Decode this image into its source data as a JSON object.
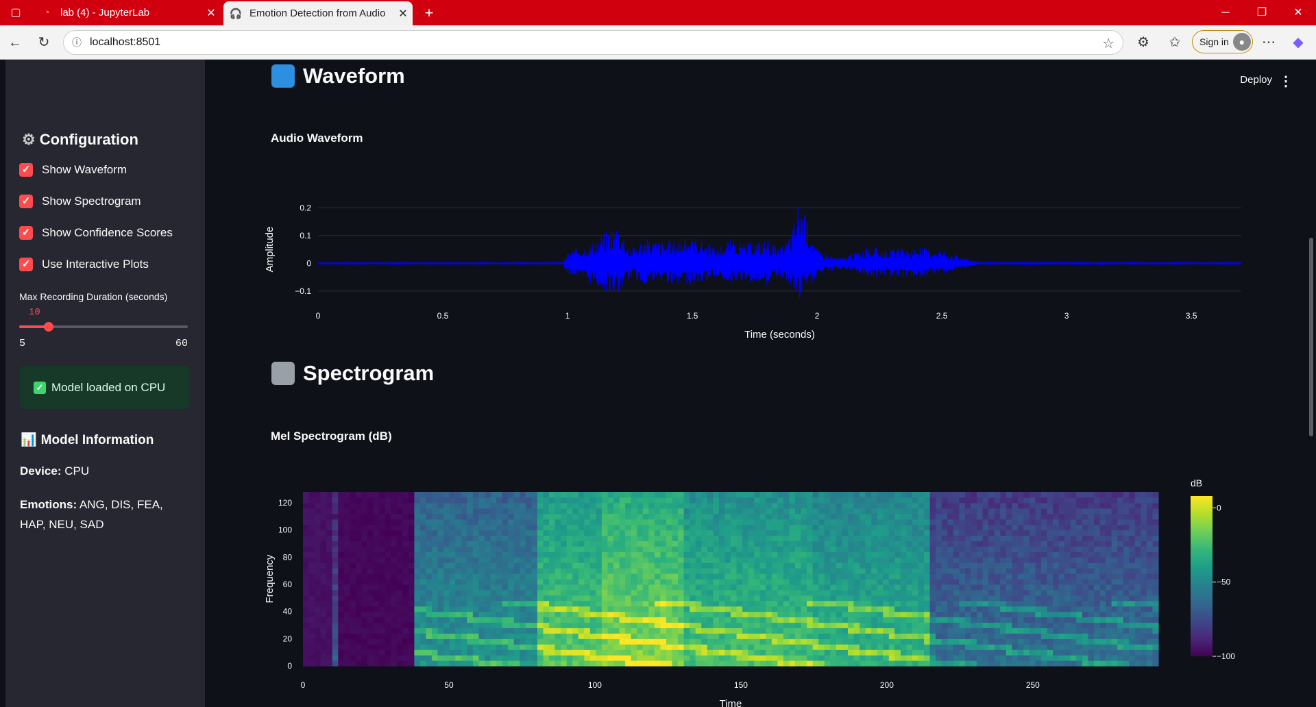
{
  "browser": {
    "tabs": [
      {
        "title": "lab (4) - JupyterLab",
        "icon": "jupyter-icon"
      },
      {
        "title": "Emotion Detection from Audio",
        "icon": "headphones-icon"
      }
    ],
    "url": "localhost:8501",
    "signin_label": "Sign in"
  },
  "sidebar": {
    "config_title": "Configuration",
    "checkboxes": [
      {
        "label": "Show Waveform",
        "checked": true
      },
      {
        "label": "Show Spectrogram",
        "checked": true
      },
      {
        "label": "Show Confidence Scores",
        "checked": true
      },
      {
        "label": "Use Interactive Plots",
        "checked": true
      }
    ],
    "slider": {
      "label": "Max Recording Duration (seconds)",
      "value": "10",
      "min": "5",
      "max": "60"
    },
    "status": "Model loaded on CPU",
    "model_info_title": "Model Information",
    "device_label": "Device:",
    "device_value": " CPU",
    "emotions_label": "Emotions:",
    "emotions_value": " ANG, DIS, FEA, HAP, NEU, SAD"
  },
  "main": {
    "deploy_label": "Deploy",
    "waveform_title": "Waveform",
    "spectrogram_title": "Spectrogram"
  },
  "chart_data": [
    {
      "type": "line",
      "title": "Audio Waveform",
      "xlabel": "Time (seconds)",
      "ylabel": "Amplitude",
      "xlim": [
        0,
        3.7
      ],
      "ylim": [
        -0.13,
        0.26
      ],
      "xticks": [
        "0",
        "0.5",
        "1",
        "1.5",
        "2",
        "2.5",
        "3",
        "3.5"
      ],
      "yticks": [
        "−0.1",
        "0",
        "0.1",
        "0.2"
      ],
      "color": "#0000ff",
      "envelope": {
        "x": [
          0,
          0.98,
          1.0,
          1.1,
          1.2,
          1.25,
          1.3,
          1.4,
          1.5,
          1.6,
          1.65,
          1.7,
          1.8,
          1.85,
          1.9,
          1.93,
          1.97,
          2.0,
          2.05,
          2.1,
          2.15,
          2.2,
          2.3,
          2.4,
          2.5,
          2.6,
          2.65,
          3.7
        ],
        "upper": [
          0.003,
          0.003,
          0.04,
          0.08,
          0.15,
          0.05,
          0.09,
          0.08,
          0.1,
          0.06,
          0.09,
          0.07,
          0.09,
          0.05,
          0.12,
          0.25,
          0.13,
          0.05,
          0.03,
          0.02,
          0.04,
          0.06,
          0.05,
          0.06,
          0.05,
          0.02,
          0.004,
          0.003
        ],
        "lower": [
          -0.003,
          -0.003,
          -0.04,
          -0.08,
          -0.12,
          -0.05,
          -0.08,
          -0.07,
          -0.08,
          -0.05,
          -0.07,
          -0.06,
          -0.08,
          -0.05,
          -0.1,
          -0.13,
          -0.1,
          -0.05,
          -0.03,
          -0.02,
          -0.03,
          -0.05,
          -0.05,
          -0.05,
          -0.04,
          -0.02,
          -0.004,
          -0.003
        ]
      }
    },
    {
      "type": "heatmap",
      "title": "Mel Spectrogram (dB)",
      "xlabel": "Time",
      "ylabel": "Frequency",
      "xlim": [
        0,
        293
      ],
      "ylim": [
        0,
        128
      ],
      "xticks": [
        "0",
        "50",
        "100",
        "150",
        "200",
        "250"
      ],
      "yticks": [
        "0",
        "20",
        "40",
        "60",
        "80",
        "100",
        "120"
      ],
      "colorbar": {
        "title": "dB",
        "ticks": [
          "0",
          "−50",
          "−100"
        ],
        "range": [
          -100,
          8
        ]
      },
      "colorscale": "viridis",
      "loud_regions": [
        {
          "x": [
            0,
            11
          ],
          "level": -95
        },
        {
          "x": [
            11,
            13
          ],
          "level": -70
        },
        {
          "x": [
            13,
            38
          ],
          "level": -98
        },
        {
          "x": [
            38,
            80
          ],
          "level": -45
        },
        {
          "x": [
            80,
            103
          ],
          "level": -20
        },
        {
          "x": [
            103,
            130
          ],
          "level": -12
        },
        {
          "x": [
            130,
            175
          ],
          "level": -25
        },
        {
          "x": [
            175,
            215
          ],
          "level": -30
        },
        {
          "x": [
            215,
            293
          ],
          "level": -60
        }
      ]
    }
  ]
}
